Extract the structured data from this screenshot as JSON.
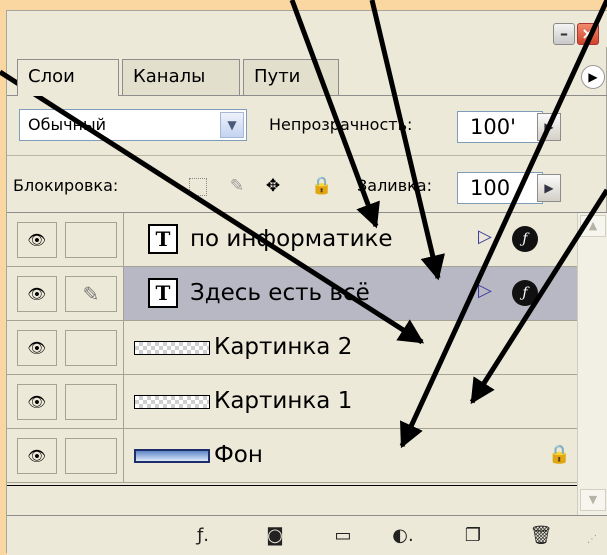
{
  "tabs": [
    {
      "label": "Слои",
      "active": true
    },
    {
      "label": "Каналы",
      "active": false
    },
    {
      "label": "Пути",
      "active": false
    }
  ],
  "blend_mode": "Обычный",
  "opacity": {
    "label": "Непрозрачность:",
    "value": "100'"
  },
  "lock": {
    "label": "Блокировка:"
  },
  "fill": {
    "label": "Заливка:",
    "value": "100"
  },
  "layers": [
    {
      "name": "по информатике",
      "type": "text",
      "visible": true,
      "selected": false,
      "has_effects": true
    },
    {
      "name": "Здесь есть всё",
      "type": "text",
      "visible": true,
      "selected": true,
      "has_effects": true,
      "brush_linked": true
    },
    {
      "name": "Картинка 2",
      "type": "image",
      "visible": true,
      "selected": false
    },
    {
      "name": "Картинка 1",
      "type": "image",
      "visible": true,
      "selected": false
    },
    {
      "name": "Фон",
      "type": "background",
      "visible": true,
      "selected": false,
      "locked": true
    }
  ],
  "colors": {
    "page_background": "#fad7a0",
    "panel": "#ece9d8",
    "selected_layer": "#b8b8c4",
    "close_button": "#d1442a"
  },
  "icons": {
    "layer_visibility": "eye-icon",
    "text_layer": "T",
    "effects": "fx-icon",
    "lock": "lock-icon",
    "bottom_bar": [
      "link-fx-icon",
      "mask-icon",
      "folder-icon",
      "adjustment-icon",
      "new-layer-icon",
      "trash-icon"
    ]
  }
}
